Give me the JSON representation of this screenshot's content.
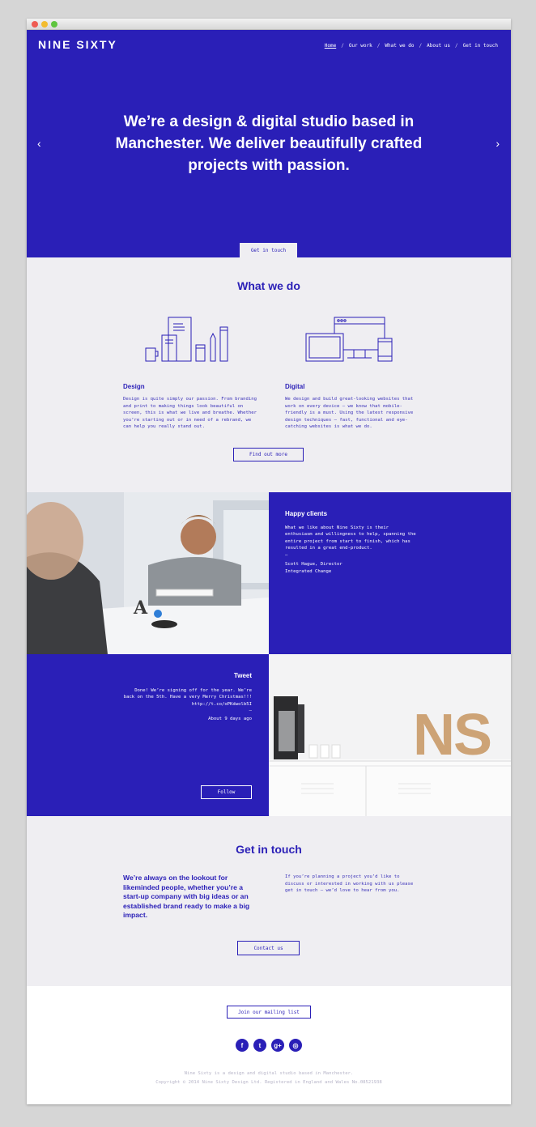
{
  "brand": {
    "logo": "NINE SIXTY",
    "blue": "#2a1fb7",
    "light_bg": "#efeef2"
  },
  "nav": {
    "items": [
      "Home",
      "Our work",
      "What we do",
      "About us",
      "Get in touch"
    ]
  },
  "hero": {
    "headline": "We’re a design & digital studio based in Manchester. We deliver beautifully crafted projects with passion.",
    "cta": "Get in touch",
    "prev_icon": "chevron-left-icon",
    "next_icon": "chevron-right-icon"
  },
  "what_we_do": {
    "title": "What we do",
    "design": {
      "title": "Design",
      "text": "Design is quite simply our passion. From branding and print to making things look beautiful on screen, this is what we live and breathe. Whether you’re starting out or in need of a rebrand, we can help you really stand out."
    },
    "digital": {
      "title": "Digital",
      "text": "We design and build great-looking websites that work on every device – we know that mobile-friendly is a must. Using the latest responsive design techniques – fast, functional and eye-catching websites is what we do."
    },
    "button": "Find out more"
  },
  "testimonial": {
    "title": "Happy clients",
    "quote": "What we like about Nine Sixty is their enthusiasm and willingness to help, spanning the entire project from start to finish, which has resulted in a great end-product.",
    "dash": "—",
    "author": "Scott Hague, Director",
    "company": "Integrated Change"
  },
  "tweet": {
    "title": "Tweet",
    "text": "Done! We’re signing off for the year. We’re back on the 5th. Have a very Merry Christmas!!! http://t.co/oPKdwolb5I",
    "dash": "—",
    "time": "About 9 days ago",
    "button": "Follow"
  },
  "photo2": {
    "letters": "NS"
  },
  "contact": {
    "title": "Get in touch",
    "lead": "We’re always on the lookout for likeminded people, whether you’re a start-up company with big ideas or an established brand ready to make a big impact.",
    "text": "If you’re planning a project you’d like to discuss or interested in working with us please get in touch – we’d love to hear from you.",
    "button": "Contact us"
  },
  "footer": {
    "mailing": "Join our mailing list",
    "social": [
      {
        "icon": "facebook-icon",
        "glyph": "f"
      },
      {
        "icon": "twitter-icon",
        "glyph": "t"
      },
      {
        "icon": "google-plus-icon",
        "glyph": "g+"
      },
      {
        "icon": "instagram-icon",
        "glyph": "◎"
      }
    ],
    "line1": "Nine Sixty is a design and digital studio based in Manchester.",
    "line2": "Copyright © 2014 Nine Sixty Design Ltd. Registered in England and Wales No.08521938"
  }
}
